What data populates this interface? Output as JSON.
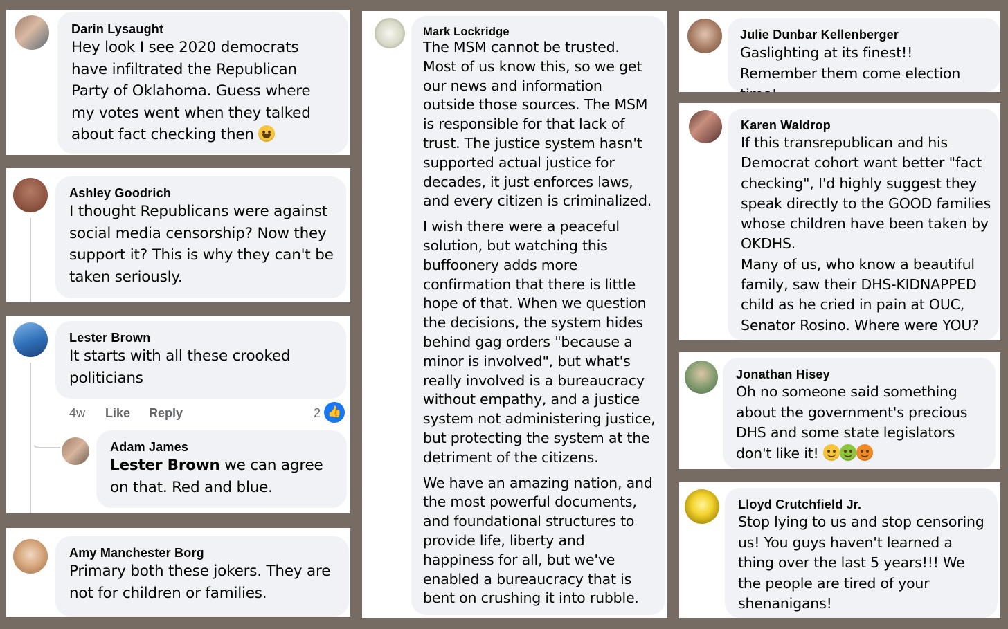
{
  "comments": {
    "darin": {
      "name": "Darin Lysaught",
      "text": "Hey look I see 2020 democrats have infiltrated the Republican Party of Oklahoma. Guess where my votes went when they talked about fact checking then"
    },
    "ashley": {
      "name": "Ashley Goodrich",
      "text": "I thought Republicans were against social media censorship? Now they support it? This is why they can't be taken seriously."
    },
    "lester": {
      "name": "Lester Brown",
      "text": "It starts with all these crooked politicians",
      "time": "4w",
      "like": "Like",
      "reply": "Reply",
      "reactions": "2"
    },
    "adam": {
      "name": "Adam James",
      "mention": "Lester Brown",
      "text": " we can agree on that. Red and blue."
    },
    "amy": {
      "name": "Amy Manchester Borg",
      "text": "Primary both these jokers. They are not for children or families."
    },
    "mark": {
      "name": "Mark Lockridge",
      "p1": "The MSM cannot be trusted. Most of us know this, so we get our news and information outside those sources. The MSM is responsible for that lack of trust. The justice system hasn't supported actual justice for decades, it just enforces laws, and every citizen is criminalized.",
      "p2": "I wish there were a peaceful solution, but watching this buffoonery adds more confirmation that there is little hope of that. When we question the decisions, the system hides behind gag orders \"because a minor is involved\", but what's really involved is a bureaucracy without empathy, and a justice system not administering justice, but protecting the system at the detriment of the citizens.",
      "p3": "We have an amazing nation, and the most powerful documents, and foundational structures to provide life, liberty and happiness for all, but we've enabled a bureaucracy that is bent on crushing it into rubble."
    },
    "julie": {
      "name": "Julie Dunbar Kellenberger",
      "text": "Gaslighting at its finest!! Remember them come election time!"
    },
    "karen": {
      "name": "Karen Waldrop",
      "p1": "If this transrepublican and his Democrat cohort want better \"fact checking\", I'd highly suggest they speak directly to the GOOD families whose children have been taken by OKDHS.",
      "p2": "Many of us, who know a beautiful family, saw their DHS-KIDNAPPED child as he cried in pain at OUC, Senator Rosino. Where were YOU?"
    },
    "jonathan": {
      "name": "Jonathan Hisey",
      "text": "Oh no someone said something about the government's precious DHS and some state legislators don't like it!"
    },
    "lloyd": {
      "name": "Lloyd Crutchfield Jr.",
      "text": "Stop lying to us and stop censoring us! You guys haven't learned a thing over the last 5 years!!! We the people are tired of your shenanigans!"
    }
  },
  "colors": {
    "background": "#776c63",
    "bubble": "#f0f2f5",
    "like_blue": "#1877f2"
  },
  "icons": [
    "laughing-emoji-icon",
    "rolling-eyes-emoji-icon",
    "nauseated-emoji-icon",
    "angry-emoji-icon",
    "like-thumb-icon"
  ]
}
